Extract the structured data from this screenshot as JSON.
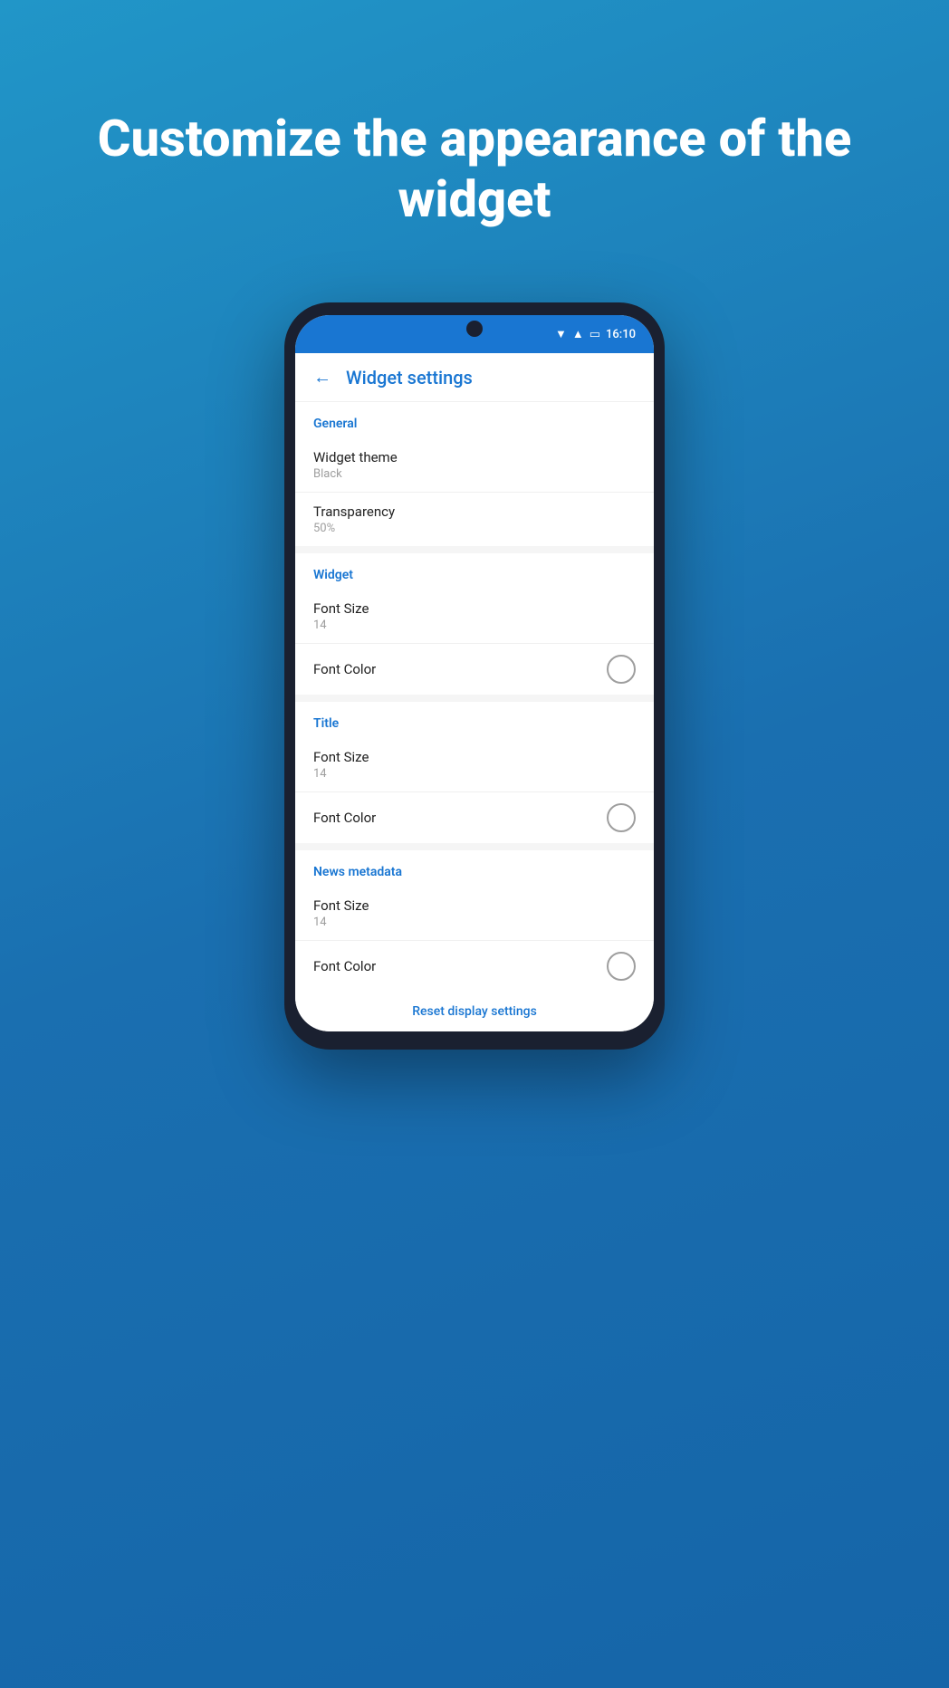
{
  "hero": {
    "title": "Customize the appearance of the widget"
  },
  "statusBar": {
    "time": "16:10"
  },
  "appBar": {
    "backIcon": "←",
    "title": "Widget settings"
  },
  "sections": [
    {
      "id": "general",
      "header": "General",
      "items": [
        {
          "label": "Widget theme",
          "value": "Black",
          "hasCircle": false
        },
        {
          "label": "Transparency",
          "value": "50%",
          "hasCircle": false
        }
      ]
    },
    {
      "id": "widget",
      "header": "Widget",
      "items": [
        {
          "label": "Font Size",
          "value": "14",
          "hasCircle": false
        },
        {
          "label": "Font Color",
          "value": "",
          "hasCircle": true
        }
      ]
    },
    {
      "id": "title",
      "header": "Title",
      "items": [
        {
          "label": "Font Size",
          "value": "14",
          "hasCircle": false
        },
        {
          "label": "Font Color",
          "value": "",
          "hasCircle": true
        }
      ]
    },
    {
      "id": "news-metadata",
      "header": "News metadata",
      "items": [
        {
          "label": "Font Size",
          "value": "14",
          "hasCircle": false
        },
        {
          "label": "Font Color",
          "value": "",
          "hasCircle": true
        }
      ]
    }
  ],
  "resetLink": "Reset display settings"
}
